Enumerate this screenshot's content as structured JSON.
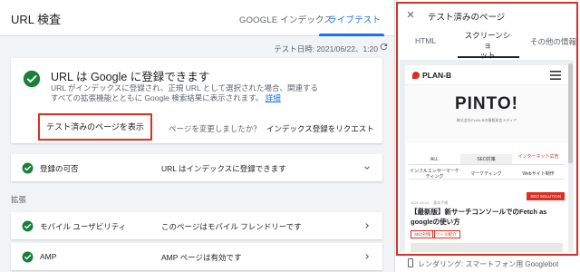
{
  "app": {
    "title": "URL 検査"
  },
  "tabs": {
    "google_index": "GOOGLE インデックス",
    "live_test": "ライブテスト"
  },
  "test_date": "テスト日時: 2021/06/22、1:20",
  "main_card": {
    "heading": "URL は Google に登録できます",
    "description": "URL がインデックスに登録され、正規 URL として選択された場合、関連するすべての拡張機能とともに Google 検索結果に表示されます。",
    "details_link": "詳細",
    "view_tested_page": "テスト済みのページを表示",
    "changed_question": "ページを変更しましたか？",
    "request_indexing": "インデックス登録をリクエスト"
  },
  "rows": [
    {
      "label": "登録の可否",
      "value": "URL はインデックスに登録できます"
    },
    {
      "label": "モバイル ユーザビリティ",
      "value": "このページはモバイル フレンドリーです"
    },
    {
      "label": "AMP",
      "value": "AMP ページは有効です"
    }
  ],
  "section_enhancements": "拡張",
  "panel": {
    "title": "テスト済みのページ",
    "tabs": {
      "html": "HTML",
      "screenshot_line1": "スクリーンショ",
      "screenshot_line2": "ット",
      "other": "その他の情報"
    },
    "render_note": "レンダリング: スマートフォン用 Googlebot"
  },
  "screenshot": {
    "logo": "PLAN-B",
    "brand": "PINTO!",
    "brand_sub": "株式会社PLAN-Bの情報発信メディア",
    "nav": [
      "ALL",
      "SEO対策",
      "インターネット広告",
      "インフルエンサーマーケティング",
      "マーケティング",
      "Webサイト制作"
    ],
    "badge": "SEO SOLUTION",
    "meta": "2021.03.23  　基本手順",
    "article_title": "【最新版】新サーチコンソールでのFetch as googleの使い方",
    "tags": [
      "SEO対策",
      "ツール紹介"
    ]
  },
  "colors": {
    "accent": "#1a73e8",
    "success": "#188038",
    "highlight": "#d93025"
  }
}
